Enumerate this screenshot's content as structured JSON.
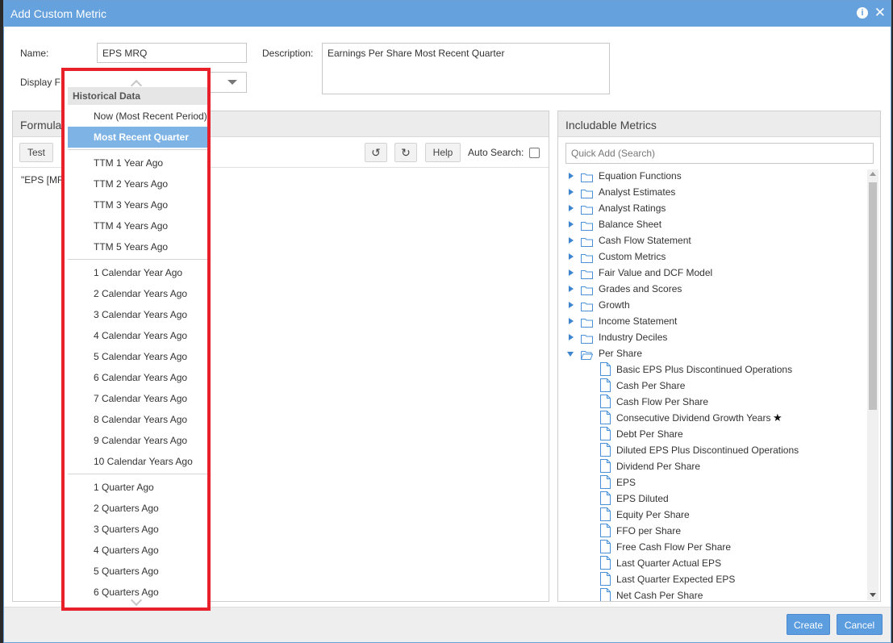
{
  "dialog": {
    "title": "Add Custom Metric",
    "info_icon": "i",
    "close_icon": "✕"
  },
  "form": {
    "name_label": "Name:",
    "name_value": "EPS MRQ",
    "description_label": "Description:",
    "description_value": "Earnings Per Share Most Recent Quarter",
    "display_label": "Display F"
  },
  "formula_panel": {
    "title": "Formula",
    "test_label": "Test",
    "help_label": "Help",
    "auto_search_label": "Auto Search:",
    "formula_text": "\"EPS [MR"
  },
  "dropdown": {
    "group_label": "Historical Data",
    "items": [
      {
        "label": "Now (Most Recent Period)",
        "selected": false
      },
      {
        "label": "Most Recent Quarter",
        "selected": true
      },
      {
        "label": "TTM 1 Year Ago"
      },
      {
        "label": "TTM 2 Years Ago"
      },
      {
        "label": "TTM 3 Years Ago"
      },
      {
        "label": "TTM 4 Years Ago"
      },
      {
        "label": "TTM 5 Years Ago"
      },
      {
        "label": "1 Calendar Year Ago"
      },
      {
        "label": "2 Calendar Years Ago"
      },
      {
        "label": "3 Calendar Years Ago"
      },
      {
        "label": "4 Calendar Years Ago"
      },
      {
        "label": "5 Calendar Years Ago"
      },
      {
        "label": "6 Calendar Years Ago"
      },
      {
        "label": "7 Calendar Years Ago"
      },
      {
        "label": "8 Calendar Years Ago"
      },
      {
        "label": "9 Calendar Years Ago"
      },
      {
        "label": "10 Calendar Years Ago"
      },
      {
        "label": "1 Quarter Ago"
      },
      {
        "label": "2 Quarters Ago"
      },
      {
        "label": "3 Quarters Ago"
      },
      {
        "label": "4 Quarters Ago"
      },
      {
        "label": "5 Quarters Ago"
      },
      {
        "label": "6 Quarters Ago"
      }
    ]
  },
  "metrics_panel": {
    "title": "Includable Metrics",
    "search_placeholder": "Quick Add (Search)",
    "folders": [
      "Equation Functions",
      "Analyst Estimates",
      "Analyst Ratings",
      "Balance Sheet",
      "Cash Flow Statement",
      "Custom Metrics",
      "Fair Value and DCF Model",
      "Grades and Scores",
      "Growth",
      "Income Statement",
      "Industry Deciles"
    ],
    "open_folder": "Per Share",
    "metrics": [
      "Basic EPS Plus Discontinued Operations",
      "Cash Per Share",
      "Cash Flow Per Share",
      "Consecutive Dividend Growth Years",
      "Debt Per Share",
      "Diluted EPS Plus Discontinued Operations",
      "Dividend Per Share",
      "EPS",
      "EPS Diluted",
      "Equity Per Share",
      "FFO per Share",
      "Free Cash Flow Per Share",
      "Last Quarter Actual EPS",
      "Last Quarter Expected EPS",
      "Net Cash Per Share"
    ],
    "star_glyph": "★"
  },
  "footer": {
    "create_label": "Create",
    "cancel_label": "Cancel"
  },
  "colors": {
    "title_bar": "#65a1dd",
    "primary_button": "#5b9ddf",
    "dropdown_border": "#e8202a",
    "selected_item": "#7eb3e6"
  }
}
